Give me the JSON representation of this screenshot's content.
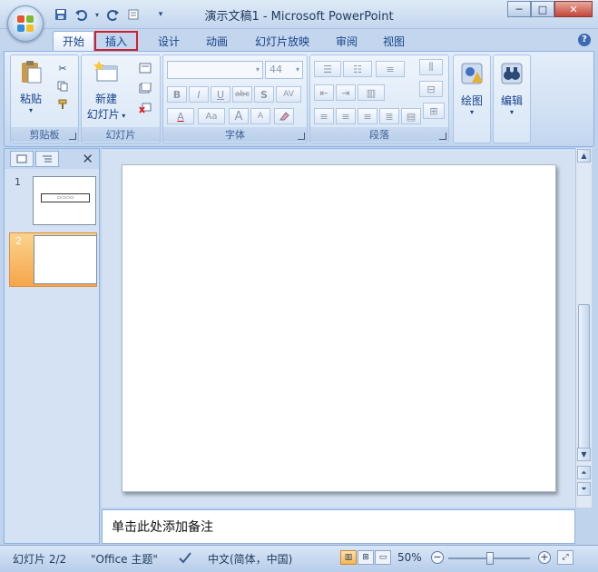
{
  "window": {
    "title": "演示文稿1 - Microsoft PowerPoint",
    "minimize": "─",
    "maximize": "□",
    "close": "✕"
  },
  "qat": {
    "save_icon": "save-icon",
    "undo_icon": "undo-icon",
    "redo_icon": "redo-icon",
    "customize_icon": "chevron-down-icon"
  },
  "tabs": [
    {
      "label": "开始",
      "active": true
    },
    {
      "label": "插入",
      "highlighted": true
    },
    {
      "label": "设计"
    },
    {
      "label": "动画"
    },
    {
      "label": "幻灯片放映"
    },
    {
      "label": "审阅"
    },
    {
      "label": "视图"
    }
  ],
  "ribbon": {
    "clipboard": {
      "label": "剪贴板",
      "paste": "粘贴"
    },
    "slides": {
      "label": "幻灯片",
      "new_slide_line1": "新建",
      "new_slide_line2": "幻灯片"
    },
    "font": {
      "label": "字体",
      "font_size": "44",
      "bold": "B",
      "italic": "I",
      "underline": "U",
      "strike": "abc",
      "shadow": "S",
      "spacing": "AV",
      "font_color": "A",
      "change_case": "Aa",
      "grow": "A",
      "shrink": "A"
    },
    "paragraph": {
      "label": "段落"
    },
    "drawing": {
      "label": "绘图"
    },
    "editing": {
      "label": "编辑"
    }
  },
  "slides_pane": {
    "close": "✕",
    "slides": [
      {
        "number": "1",
        "mini_title": "▭▭▭▭"
      },
      {
        "number": "2",
        "selected": true
      }
    ]
  },
  "notes": {
    "placeholder": "单击此处添加备注"
  },
  "status": {
    "slide_info": "幻灯片 2/2",
    "theme": "\"Office 主题\"",
    "language": "中文(简体，中国)",
    "zoom": "50%",
    "zoom_minus": "−",
    "zoom_plus": "+"
  }
}
